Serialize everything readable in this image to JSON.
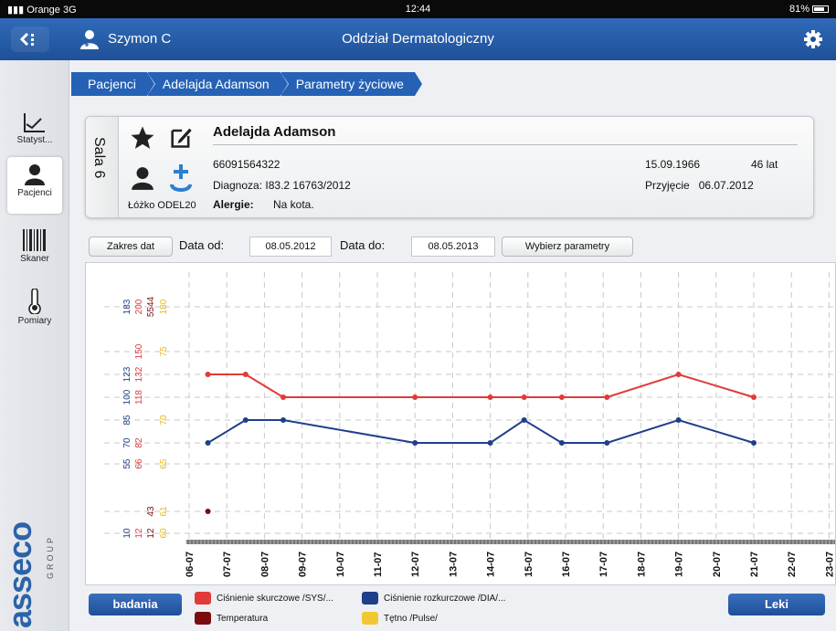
{
  "status_bar": {
    "carrier": "Orange",
    "network": "3G",
    "time": "12:44",
    "battery": "81%",
    "battery_level": 0.81
  },
  "header": {
    "back_icon": "menu-back-icon",
    "user_name": "Szymon C",
    "department": "Oddział Dermatologiczny",
    "settings_icon": "gear-icon"
  },
  "breadcrumb": [
    "Pacjenci",
    "Adelajda  Adamson",
    "Parametry życiowe"
  ],
  "sidebar": {
    "items": [
      {
        "label": "Statyst...",
        "icon": "chart-icon"
      },
      {
        "label": "Pacjenci",
        "icon": "person-icon",
        "active": true
      },
      {
        "label": "Skaner",
        "icon": "barcode-icon"
      },
      {
        "label": "Pomiary",
        "icon": "thermometer-icon"
      }
    ],
    "logo": "asseco",
    "logo_sub": "GROUP"
  },
  "patient": {
    "room": "Sala 6",
    "name": "Adelajda  Adamson",
    "pesel": "66091564322",
    "diagnosis_label": "Diagnoza:",
    "diagnosis_value": "I83.2  16763/2012",
    "bed": "Łóżko ODEL20",
    "allergies_label": "Alergie:",
    "allergies_value": "Na kota.",
    "birth_date": "15.09.1966",
    "age": "46 lat",
    "admission_label": "Przyjęcie",
    "admission_date": "06.07.2012"
  },
  "filters": {
    "range_button": "Zakres dat",
    "from_label": "Data od:",
    "from_value": "08.05.2012",
    "to_label": "Data do:",
    "to_value": "08.05.2013",
    "params_button": "Wybierz parametry"
  },
  "chart_data": {
    "type": "line",
    "x": [
      "06-07",
      "07-07",
      "08-07",
      "09-07",
      "10-07",
      "11-07",
      "12-07",
      "13-07",
      "14-07",
      "15-07",
      "16-07",
      "17-07",
      "18-07",
      "19-07",
      "20-07",
      "21-07",
      "22-07",
      "23-07"
    ],
    "y_axes": [
      {
        "color": "#1f3f8a",
        "ticks": [
          "10",
          "55",
          "70",
          "85",
          "100",
          "123",
          "183"
        ]
      },
      {
        "color": "#e23a3a",
        "ticks": [
          "12",
          "66",
          "82",
          "",
          "118",
          "132",
          "150",
          "200"
        ]
      },
      {
        "color": "#7a0e0e",
        "ticks": [
          "43",
          "5544"
        ]
      },
      {
        "color": "#e8b820",
        "ticks": [
          "60",
          "61",
          "65",
          "70",
          "75",
          "180"
        ]
      }
    ],
    "series": [
      {
        "name": "Ciśnienie skurczowe /SYS/...",
        "color": "#e23a3a",
        "points": [
          [
            0.5,
            132
          ],
          [
            1.5,
            132
          ],
          [
            2.5,
            118
          ],
          [
            6.0,
            118
          ],
          [
            8.0,
            118
          ],
          [
            8.9,
            118
          ],
          [
            9.9,
            118
          ],
          [
            11.1,
            118
          ],
          [
            13.0,
            132
          ],
          [
            15.0,
            118
          ]
        ]
      },
      {
        "name": "Ciśnienie rozkurczowe /DIA/...",
        "color": "#1f3f8a",
        "points": [
          [
            0.5,
            70
          ],
          [
            1.5,
            85
          ],
          [
            2.5,
            85
          ],
          [
            6.0,
            70
          ],
          [
            8.0,
            70
          ],
          [
            8.9,
            85
          ],
          [
            9.9,
            70
          ],
          [
            11.1,
            70
          ],
          [
            13.0,
            85
          ],
          [
            15.0,
            70
          ]
        ]
      },
      {
        "name": "Temperatura",
        "color": "#7a0e0e",
        "points": [
          [
            0.5,
            43
          ]
        ]
      },
      {
        "name": "Tętno /Pulse/",
        "color": "#f0c832",
        "points": []
      }
    ]
  },
  "legend": [
    {
      "label": "Ciśnienie skurczowe /SYS/...",
      "color": "#e23a3a"
    },
    {
      "label": "Ciśnienie rozkurczowe /DIA/...",
      "color": "#1f3f8a"
    },
    {
      "label": "Temperatura",
      "color": "#7a0e0e"
    },
    {
      "label": "Tętno /Pulse/",
      "color": "#f0c832"
    }
  ],
  "bottom": {
    "badania": "badania",
    "leki": "Leki"
  }
}
